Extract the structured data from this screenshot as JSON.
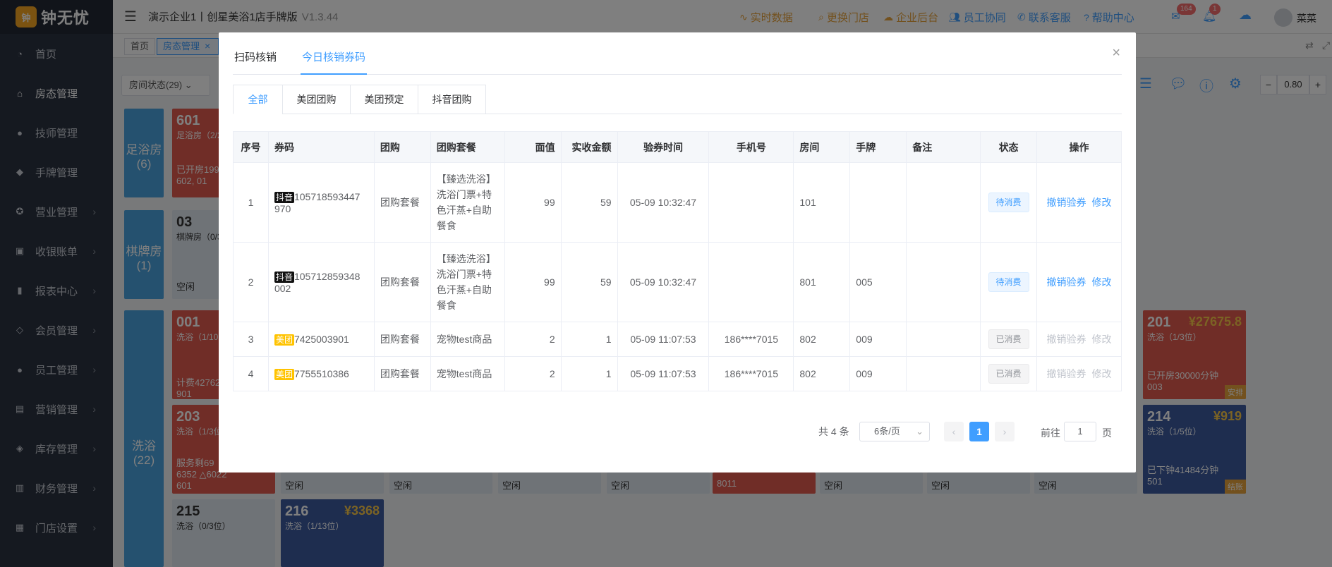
{
  "app": {
    "logo_mark": "钟",
    "logo_text": "钟无忧",
    "title": "演示企业1丨创星美浴1店手牌版",
    "version": "V1.3.44"
  },
  "sidebar": {
    "items": [
      {
        "label": "首页",
        "icon": "dashboard-icon",
        "chevron": false
      },
      {
        "label": "房态管理",
        "icon": "home-icon",
        "chevron": false
      },
      {
        "label": "技师管理",
        "icon": "person-icon",
        "chevron": false
      },
      {
        "label": "手牌管理",
        "icon": "tag-icon",
        "chevron": false
      },
      {
        "label": "营业管理",
        "icon": "business-icon",
        "chevron": true
      },
      {
        "label": "收银账单",
        "icon": "wallet-icon",
        "chevron": true
      },
      {
        "label": "报表中心",
        "icon": "chart-icon",
        "chevron": true
      },
      {
        "label": "会员管理",
        "icon": "diamond-icon",
        "chevron": true
      },
      {
        "label": "员工管理",
        "icon": "staff-icon",
        "chevron": true
      },
      {
        "label": "营销管理",
        "icon": "marketing-icon",
        "chevron": true
      },
      {
        "label": "库存管理",
        "icon": "box-icon",
        "chevron": true
      },
      {
        "label": "财务管理",
        "icon": "finance-icon",
        "chevron": true
      },
      {
        "label": "门店设置",
        "icon": "grid-icon",
        "chevron": true
      }
    ]
  },
  "header": {
    "links": [
      {
        "label": "实时数据",
        "icon": "realtime-icon",
        "color": "#e6a23c"
      },
      {
        "label": "更换门店",
        "icon": "search-icon",
        "color": "#e6a23c"
      },
      {
        "label": "企业后台",
        "icon": "cloud-icon",
        "color": "#e6a23c"
      },
      {
        "label": "员工协同",
        "icon": "team-icon",
        "color": "#409eff"
      },
      {
        "label": "联系客服",
        "icon": "phone-icon",
        "color": "#409eff"
      },
      {
        "label": "帮助中心",
        "icon": "help-icon",
        "color": "#409eff"
      }
    ],
    "mail_badge": "164",
    "bell_badge": "1",
    "user_name": "菜菜"
  },
  "tabbar": {
    "home": "首页",
    "active": "房态管理",
    "close": "×"
  },
  "filter": {
    "room_status": "房间状态(29)",
    "zoom": "0.80",
    "minus": "−",
    "plus": "+"
  },
  "background": {
    "categories": [
      {
        "label": "足浴房",
        "count": "(6)"
      },
      {
        "label": "棋牌房",
        "count": "(1)"
      },
      {
        "label": "洗浴",
        "count": "(22)"
      }
    ],
    "rooms": [
      {
        "num": "601",
        "sub": "足浴房（2/2",
        "line1": "已开房199",
        "line2": "602, 01"
      },
      {
        "num": "03",
        "sub": "棋牌房（0/3",
        "line1": "空闲",
        "line2": ""
      },
      {
        "num": "001",
        "sub": "洗浴（1/10",
        "line1": "计费42762",
        "line2": "901"
      },
      {
        "num": "203",
        "sub": "洗浴（1/3位",
        "line1": "服务剩69",
        "line2": "6352 △6022",
        "line3": "601"
      },
      {
        "num": "215",
        "sub": "洗浴（0/3位）",
        "line1": "",
        "line2": ""
      },
      {
        "num": "216",
        "sub": "洗浴（1/13位）",
        "price": "¥3368"
      },
      {
        "num": "201",
        "sub": "洗浴（1/3位）",
        "price": "¥27675.8",
        "line1": "已开房30000分钟",
        "line2": "003",
        "flag": "安排"
      },
      {
        "num": "214",
        "sub": "洗浴（1/5位）",
        "price": "¥919",
        "line1": "已下钟41484分钟",
        "line2": "501",
        "flag": "结账"
      }
    ],
    "idle_label": "空闲",
    "room_8011": "8011"
  },
  "modal": {
    "tabs": [
      "扫码核销",
      "今日核销券码"
    ],
    "active_tab": 1,
    "close": "×",
    "channel_tabs": [
      "全部",
      "美团团购",
      "美团预定",
      "抖音团购"
    ],
    "table": {
      "headers": [
        "序号",
        "券码",
        "团购",
        "团购套餐",
        "面值",
        "实收金额",
        "验券时间",
        "手机号",
        "房间",
        "手牌",
        "备注",
        "状态",
        "操作"
      ],
      "rows": [
        {
          "idx": "1",
          "source": "抖音",
          "source_type": "dy",
          "code": "105718593447970",
          "code_l1": "105718593447",
          "code_l2": "970",
          "group": "团购套餐",
          "pkg_l1": "【臻选洗浴】",
          "pkg_l2": "洗浴门票+特",
          "pkg_l3": "色汗蒸+自助",
          "pkg_l4": "餐食",
          "face": "99",
          "paid": "59",
          "time": "05-09 10:32:47",
          "phone": "",
          "room": "101",
          "tag": "",
          "note": "",
          "status": "待消费",
          "status_type": "pend",
          "op1": "撤销验券",
          "op2": "修改",
          "op_enabled": true
        },
        {
          "idx": "2",
          "source": "抖音",
          "source_type": "dy",
          "code": "105712859348002",
          "code_l1": "105712859348",
          "code_l2": "002",
          "group": "团购套餐",
          "pkg_l1": "【臻选洗浴】",
          "pkg_l2": "洗浴门票+特",
          "pkg_l3": "色汗蒸+自助",
          "pkg_l4": "餐食",
          "face": "99",
          "paid": "59",
          "time": "05-09 10:32:47",
          "phone": "",
          "room": "801",
          "tag": "005",
          "note": "",
          "status": "待消费",
          "status_type": "pend",
          "op1": "撤销验券",
          "op2": "修改",
          "op_enabled": true
        },
        {
          "idx": "3",
          "source": "美团",
          "source_type": "mt",
          "code": "7425003901",
          "group": "团购套餐",
          "pkg": "宠物test商品",
          "face": "2",
          "paid": "1",
          "time": "05-09 11:07:53",
          "phone": "186****7015",
          "room": "802",
          "tag": "009",
          "note": "",
          "status": "已消费",
          "status_type": "done",
          "op1": "撤销验券",
          "op2": "修改",
          "op_enabled": false
        },
        {
          "idx": "4",
          "source": "美团",
          "source_type": "mt",
          "code": "7755510386",
          "group": "团购套餐",
          "pkg": "宠物test商品",
          "face": "2",
          "paid": "1",
          "time": "05-09 11:07:53",
          "phone": "186****7015",
          "room": "802",
          "tag": "009",
          "note": "",
          "status": "已消费",
          "status_type": "done",
          "op1": "撤销验券",
          "op2": "修改",
          "op_enabled": false
        }
      ]
    },
    "pagination": {
      "total": "共 4 条",
      "page_size": "6条/页",
      "current_page": "1",
      "goto_label": "前往",
      "goto_value": "1",
      "page_unit": "页"
    }
  }
}
